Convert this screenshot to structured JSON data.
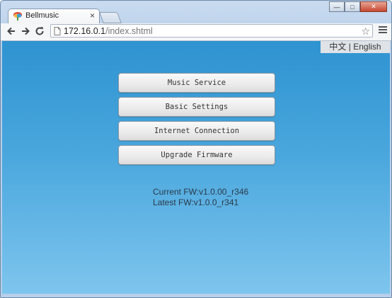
{
  "browser": {
    "tab": {
      "title": "Bellmusic",
      "close_glyph": "×",
      "favicon": "bellmusic-logo-icon"
    },
    "window_controls": {
      "minimize": "—",
      "maximize": "□",
      "close": "✕"
    },
    "address_bar": {
      "host": "172.16.0.1",
      "path": "/index.shtml",
      "star_glyph": "☆"
    }
  },
  "page": {
    "language": {
      "chinese": "中文",
      "separator": "|",
      "english": "English"
    },
    "menu": [
      {
        "label": "Music Service"
      },
      {
        "label": "Basic Settings"
      },
      {
        "label": "Internet Connection"
      },
      {
        "label": "Upgrade Firmware"
      }
    ],
    "firmware": {
      "current": "Current FW:v1.0.00_r346",
      "latest": "Latest FW:v1.0.0_r341"
    }
  },
  "colors": {
    "page_gradient_top": "#2e93d1",
    "page_gradient_bottom": "#7ec5ee",
    "button_face": "#ececec"
  }
}
